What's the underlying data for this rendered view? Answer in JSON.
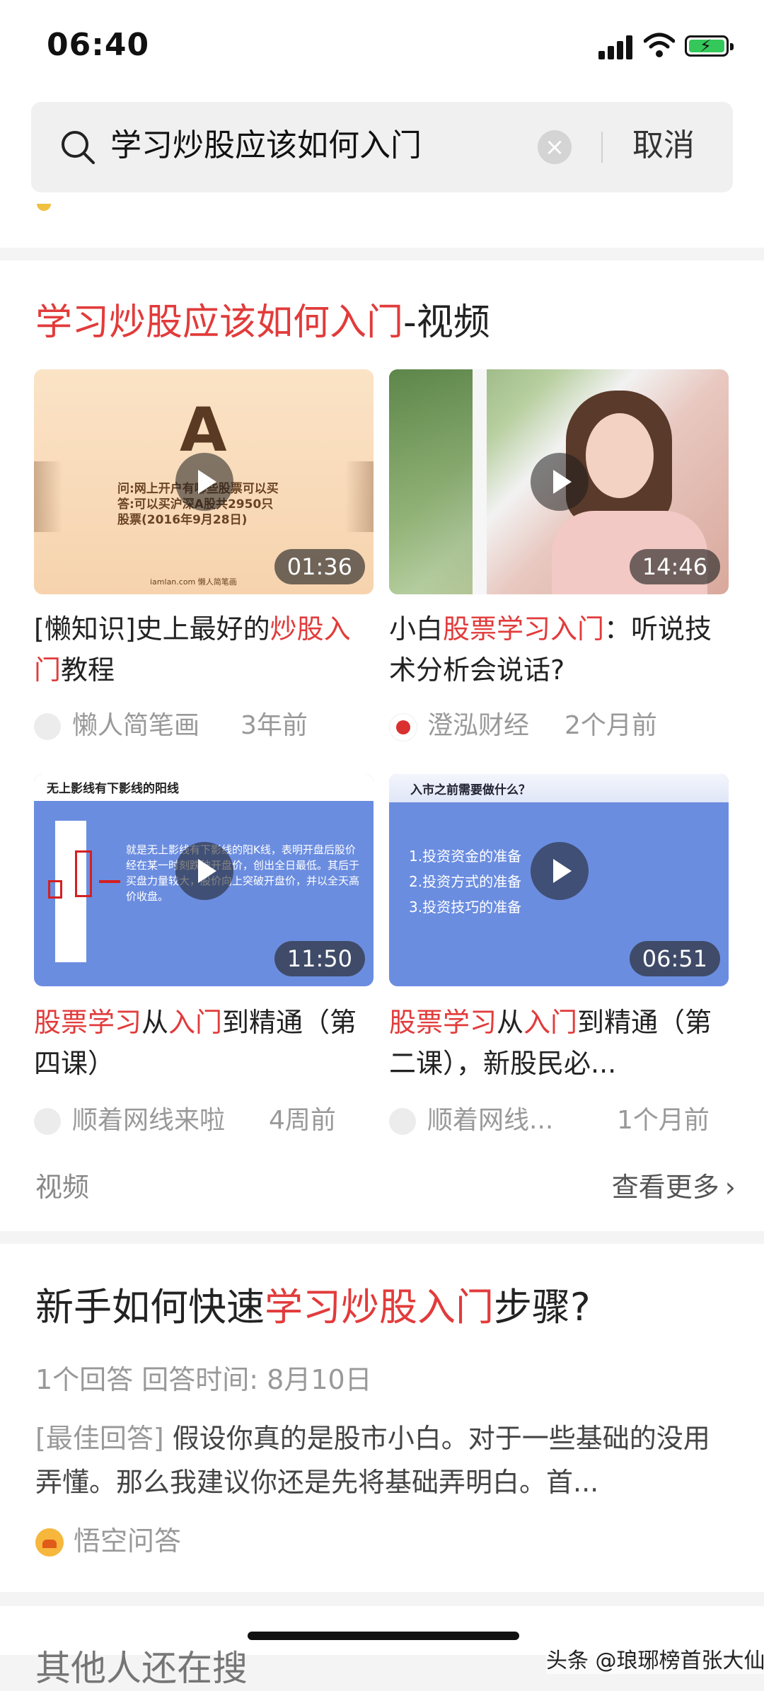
{
  "status": {
    "time": "06:40"
  },
  "search": {
    "query": "学习炒股应该如何入门",
    "cancel": "取消"
  },
  "video_section": {
    "title_highlight": "学习炒股应该如何入门",
    "title_rest": "-视频",
    "videos": [
      {
        "duration": "01:36",
        "title_parts": [
          "[懒知识]史上最好的",
          "炒股",
          "",
          "入门",
          "教程"
        ],
        "author": "懒人简笔画",
        "ago": "3年前",
        "thumb": {
          "big_letter": "A",
          "line1": "问:网上开户有哪些股票可以买",
          "line2": "答:可以买沪深A股共2950只",
          "line3": "股票(2016年9月28日)",
          "site": "iamlan.com 懒人简笔画"
        }
      },
      {
        "duration": "14:46",
        "title_parts": [
          "小白",
          "股票学习入门",
          "：听说技术分析会说话?"
        ],
        "author": "澄泓财经",
        "ago": "2个月前"
      },
      {
        "duration": "11:50",
        "title_parts": [
          "股票学习",
          "从",
          "入门",
          "到精通（第四课）"
        ],
        "author": "顺着网线来啦",
        "ago": "4周前",
        "thumb": {
          "heading": "无上影线有下影线的阳线",
          "text": "就是无上影线有下影线的阳K线，表明开盘后股价经在某一时刻跌破开盘价，创出全日最低。其后于买盘力量较大，股价向上突破开盘价，并以全天高价收盘。"
        }
      },
      {
        "duration": "06:51",
        "title_parts": [
          "股票学习",
          "从",
          "入门",
          "到精通（第二课），新股民必..."
        ],
        "author": "顺着网线...",
        "ago": "1个月前",
        "thumb": {
          "heading": "入市之前需要做什么？",
          "items": [
            "1.投资资金的准备",
            "2.投资方式的准备",
            "3.投资技巧的准备"
          ]
        }
      }
    ],
    "footer_label": "视频",
    "more": "查看更多"
  },
  "qa": {
    "title_pre": "新手如何快速",
    "title_highlight": "学习炒股入门",
    "title_post": "步骤?",
    "meta": "1个回答  回答时间: 8月10日",
    "answer_label": "[最佳回答]",
    "answer": " 假设你真的是股市小白。对于一些基础的没用弄懂。那么我建议你还是先将基础弄明白。首...",
    "source": "悟空问答"
  },
  "next_peek": "其他人还在搜",
  "watermark": "头条 @琅琊榜首张大仙",
  "colors": {
    "highlight": "#e23b3b",
    "meta": "#999999"
  }
}
